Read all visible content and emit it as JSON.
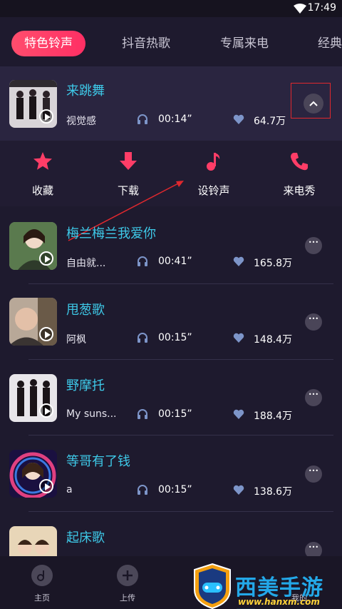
{
  "status_bar": {
    "time": "17:49"
  },
  "tabs": [
    {
      "label": "特色铃声",
      "active": true
    },
    {
      "label": "抖音热歌",
      "active": false
    },
    {
      "label": "专属来电",
      "active": false
    },
    {
      "label": "经典",
      "active": false
    }
  ],
  "songs": [
    {
      "title": "来跳舞",
      "artist": "视觉感",
      "duration": "00:14”",
      "likes": "64.7万",
      "expanded": true
    },
    {
      "title": "梅兰梅兰我爱你",
      "artist": "自由就...",
      "duration": "00:41”",
      "likes": "165.8万"
    },
    {
      "title": "甩葱歌",
      "artist": "阿枫",
      "duration": "00:15”",
      "likes": "148.4万"
    },
    {
      "title": "野摩托",
      "artist": "My suns...",
      "duration": "00:15”",
      "likes": "188.4万"
    },
    {
      "title": "等哥有了钱",
      "artist": "a",
      "duration": "00:15”",
      "likes": "138.6万"
    },
    {
      "title": "起床歌",
      "artist": "",
      "duration": "",
      "likes": ""
    }
  ],
  "actions": [
    {
      "label": "收藏",
      "icon": "star-icon"
    },
    {
      "label": "下载",
      "icon": "download-icon"
    },
    {
      "label": "设铃声",
      "icon": "music-note-icon"
    },
    {
      "label": "来电秀",
      "icon": "phone-icon"
    }
  ],
  "bottom_nav": [
    {
      "label": "主页",
      "icon": "music-disc-icon"
    },
    {
      "label": "上传",
      "icon": "plus-icon"
    },
    {
      "label": "我的",
      "icon": "user-icon"
    }
  ],
  "watermark": {
    "text": "西美手游网",
    "url": "www.hanxm.com"
  },
  "colors": {
    "accent": "#ff3d67",
    "title": "#3ec9e8",
    "background": "#1e1a2e"
  }
}
